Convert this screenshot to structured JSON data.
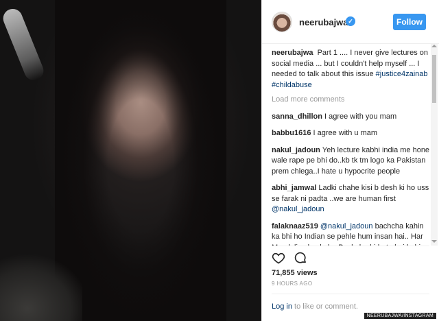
{
  "post": {
    "username": "neerubajwa",
    "follow_label": "Follow",
    "verified_mark": "✓"
  },
  "caption": {
    "username": "neerubajwa",
    "text": "Part 1 .... I never give lectures on social media ... but I couldn't help myself ... I needed to talk about this issue",
    "hashtags": "#justice4zainab #childabuse"
  },
  "load_more": "Load more comments",
  "comments": [
    {
      "username": "sanna_dhillon",
      "pre": "",
      "mention": "",
      "text": "I agree with you mam"
    },
    {
      "username": "babbu1616",
      "pre": "",
      "mention": "",
      "text": "I agree with u mam"
    },
    {
      "username": "nakul_jadoun",
      "pre": "",
      "mention": "",
      "text": "Yeh lecture kabhi india me hone wale rape pe bhi do..kb tk tm logo ka Pakistan prem chlega..I hate u hypocrite people"
    },
    {
      "username": "abhi_jamwal",
      "pre": "Ladki chahe kisi b desh ki ho uss se farak ni padta ..we are human first ",
      "mention": "@nakul_jadoun",
      "text": ""
    },
    {
      "username": "falaknaaz519",
      "pre": "",
      "mention": "@nakul_jadoun",
      "text": " bachcha kahin ka bhi ho Indian se pehle hum insan hai.. Har Maa k liye bachcha Bachcha hi hota hai kahin ka bhi kisika bhi ho... Every"
    }
  ],
  "stats": {
    "views": "71,855 views",
    "time": "9 HOURS AGO"
  },
  "footer": {
    "login_link": "Log in",
    "login_rest": " to like or comment."
  },
  "credit": "NEERUBAJWA/INSTAGRAM",
  "icons": {
    "heart": "heart-icon",
    "comment": "comment-icon"
  },
  "colors": {
    "accent": "#3897f0",
    "link": "#003569",
    "muted": "#999999"
  }
}
